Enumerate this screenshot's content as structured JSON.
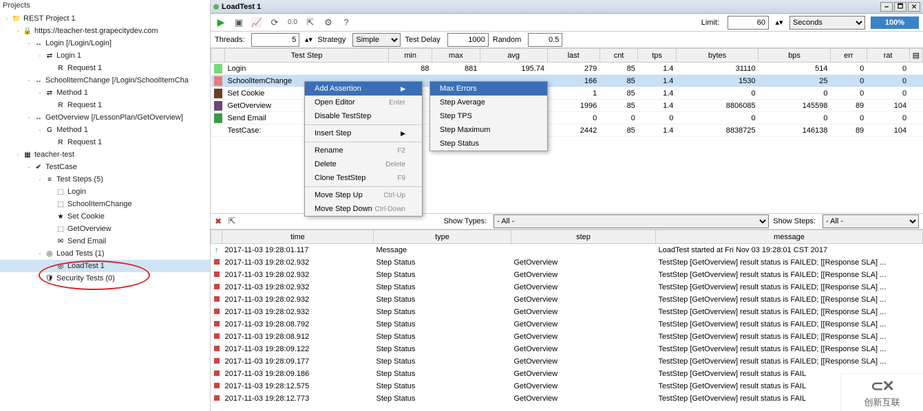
{
  "projects_header": "Projects",
  "tree": [
    {
      "indent": 0,
      "toggle": "-",
      "icon": "📁",
      "label": "REST Project 1"
    },
    {
      "indent": 1,
      "toggle": "-",
      "icon": "🔒",
      "label": "https://teacher-test.grapecitydev.com"
    },
    {
      "indent": 2,
      "toggle": "-",
      "icon": "↔",
      "label": "Login [/Login/Login]"
    },
    {
      "indent": 3,
      "toggle": "-",
      "icon": "⇄",
      "label": "Login 1"
    },
    {
      "indent": 4,
      "toggle": "",
      "icon": "R",
      "label": "Request 1"
    },
    {
      "indent": 2,
      "toggle": "-",
      "icon": "↔",
      "label": "SchoolItemChange [/Login/SchoolItemCha"
    },
    {
      "indent": 3,
      "toggle": "-",
      "icon": "⇄",
      "label": "Method 1"
    },
    {
      "indent": 4,
      "toggle": "",
      "icon": "R",
      "label": "Request 1"
    },
    {
      "indent": 2,
      "toggle": "-",
      "icon": "↔",
      "label": "GetOverview [/LessonPlan/GetOverview]"
    },
    {
      "indent": 3,
      "toggle": "-",
      "icon": "G",
      "label": "Method 1"
    },
    {
      "indent": 4,
      "toggle": "",
      "icon": "R",
      "label": "Request 1"
    },
    {
      "indent": 1,
      "toggle": "-",
      "icon": "▦",
      "label": "teacher-test"
    },
    {
      "indent": 2,
      "toggle": "-",
      "icon": "✔",
      "label": "TestCase"
    },
    {
      "indent": 3,
      "toggle": "-",
      "icon": "≡",
      "label": "Test Steps (5)"
    },
    {
      "indent": 4,
      "toggle": "",
      "icon": "⬚",
      "label": "Login"
    },
    {
      "indent": 4,
      "toggle": "",
      "icon": "⬚",
      "label": "SchoolItemChange"
    },
    {
      "indent": 4,
      "toggle": "",
      "icon": "★",
      "label": "Set Cookie"
    },
    {
      "indent": 4,
      "toggle": "",
      "icon": "⬚",
      "label": "GetOverview"
    },
    {
      "indent": 4,
      "toggle": "",
      "icon": "✉",
      "label": "Send Email"
    },
    {
      "indent": 3,
      "toggle": "-",
      "icon": "◎",
      "label": "Load Tests (1)"
    },
    {
      "indent": 4,
      "toggle": "",
      "icon": "◎",
      "label": "LoadTest 1",
      "selected": true
    },
    {
      "indent": 3,
      "toggle": "",
      "icon": "🛡",
      "label": "Security Tests (0)"
    }
  ],
  "title": "LoadTest 1",
  "limit_label": "Limit:",
  "limit_value": "60",
  "limit_unit": "Seconds",
  "progress": "100%",
  "threads_label": "Threads:",
  "threads_value": "5",
  "strategy_label": "Strategy",
  "strategy_value": "Simple",
  "testdelay_label": "Test Delay",
  "testdelay_value": "1000",
  "random_label": "Random",
  "random_value": "0.5",
  "stats_headers": [
    "Test Step",
    "min",
    "max",
    "avg",
    "last",
    "cnt",
    "tps",
    "bytes",
    "bps",
    "err",
    "rat"
  ],
  "stats_rows": [
    {
      "color": "#78d878",
      "name": "Login",
      "min": "88",
      "max": "881",
      "avg": "195.74",
      "last": "279",
      "cnt": "85",
      "tps": "1.4",
      "bytes": "31110",
      "bps": "514",
      "err": "0",
      "rat": "0"
    },
    {
      "color": "#e47f7f",
      "name": "SchoolItemChange",
      "min": "",
      "max": "",
      "avg": "",
      "last": "166",
      "cnt": "85",
      "tps": "1.4",
      "bytes": "1530",
      "bps": "25",
      "err": "0",
      "rat": "0",
      "sel": true
    },
    {
      "color": "#6b3f24",
      "name": "Set Cookie",
      "min": "",
      "max": "",
      "avg": "",
      "last": "1",
      "cnt": "85",
      "tps": "1.4",
      "bytes": "0",
      "bps": "0",
      "err": "0",
      "rat": "0"
    },
    {
      "color": "#6d4676",
      "name": "GetOverview",
      "min": "",
      "max": "",
      "avg": "",
      "last": "1996",
      "cnt": "85",
      "tps": "1.4",
      "bytes": "8806085",
      "bps": "145598",
      "err": "89",
      "rat": "104"
    },
    {
      "color": "#3a9948",
      "name": "Send Email",
      "min": "",
      "max": "",
      "avg": "",
      "last": "0",
      "cnt": "0",
      "tps": "0",
      "bytes": "0",
      "bps": "0",
      "err": "0",
      "rat": "0"
    },
    {
      "color": "",
      "name": "TestCase:",
      "min": "",
      "max": "",
      "avg": "",
      "last": "2442",
      "cnt": "85",
      "tps": "1.4",
      "bytes": "8838725",
      "bps": "146138",
      "err": "89",
      "rat": "104"
    }
  ],
  "ctx_main": [
    {
      "label": "Add Assertion",
      "arrow": true,
      "hl": true
    },
    {
      "label": "Open Editor",
      "shortcut": "Enter"
    },
    {
      "label": "Disable TestStep"
    },
    {
      "sep": true
    },
    {
      "label": "Insert Step",
      "arrow": true
    },
    {
      "sep": true
    },
    {
      "label": "Rename",
      "shortcut": "F2"
    },
    {
      "label": "Delete",
      "shortcut": "Delete"
    },
    {
      "label": "Clone TestStep",
      "shortcut": "F9"
    },
    {
      "sep": true
    },
    {
      "label": "Move Step Up",
      "shortcut": "Ctrl-Up"
    },
    {
      "label": "Move Step Down",
      "shortcut": "Ctrl-Down"
    }
  ],
  "ctx_sub": [
    {
      "label": "Max Errors",
      "hl": true
    },
    {
      "label": "Step Average"
    },
    {
      "label": "Step TPS"
    },
    {
      "label": "Step Maximum"
    },
    {
      "label": "Step Status"
    }
  ],
  "show_types_label": "Show Types:",
  "show_types_value": "- All -",
  "show_steps_label": "Show Steps:",
  "show_steps_value": "- All -",
  "log_headers": [
    "",
    "time",
    "type",
    "step",
    "message"
  ],
  "log_rows": [
    {
      "dot": "g",
      "start": true,
      "time": "2017-11-03 19:28:01.117",
      "type": "Message",
      "step": "",
      "msg": "LoadTest started at Fri Nov 03 19:28:01 CST 2017"
    },
    {
      "dot": "r",
      "time": "2017-11-03 19:28:02.932",
      "type": "Step Status",
      "step": "GetOverview",
      "msg": "TestStep [GetOverview] result status is FAILED; [[Response SLA] ..."
    },
    {
      "dot": "r",
      "time": "2017-11-03 19:28:02.932",
      "type": "Step Status",
      "step": "GetOverview",
      "msg": "TestStep [GetOverview] result status is FAILED; [[Response SLA] ..."
    },
    {
      "dot": "r",
      "time": "2017-11-03 19:28:02.932",
      "type": "Step Status",
      "step": "GetOverview",
      "msg": "TestStep [GetOverview] result status is FAILED; [[Response SLA] ..."
    },
    {
      "dot": "r",
      "time": "2017-11-03 19:28:02.932",
      "type": "Step Status",
      "step": "GetOverview",
      "msg": "TestStep [GetOverview] result status is FAILED; [[Response SLA] ..."
    },
    {
      "dot": "r",
      "time": "2017-11-03 19:28:02.932",
      "type": "Step Status",
      "step": "GetOverview",
      "msg": "TestStep [GetOverview] result status is FAILED; [[Response SLA] ..."
    },
    {
      "dot": "r",
      "time": "2017-11-03 19:28:08.792",
      "type": "Step Status",
      "step": "GetOverview",
      "msg": "TestStep [GetOverview] result status is FAILED; [[Response SLA] ..."
    },
    {
      "dot": "r",
      "time": "2017-11-03 19:28:08.912",
      "type": "Step Status",
      "step": "GetOverview",
      "msg": "TestStep [GetOverview] result status is FAILED; [[Response SLA] ..."
    },
    {
      "dot": "r",
      "time": "2017-11-03 19:28:09.122",
      "type": "Step Status",
      "step": "GetOverview",
      "msg": "TestStep [GetOverview] result status is FAILED; [[Response SLA] ..."
    },
    {
      "dot": "r",
      "time": "2017-11-03 19:28:09.177",
      "type": "Step Status",
      "step": "GetOverview",
      "msg": "TestStep [GetOverview] result status is FAILED; [[Response SLA] ..."
    },
    {
      "dot": "r",
      "time": "2017-11-03 19:28:09.186",
      "type": "Step Status",
      "step": "GetOverview",
      "msg": "TestStep [GetOverview] result status is FAIL"
    },
    {
      "dot": "r",
      "time": "2017-11-03 19:28:12.575",
      "type": "Step Status",
      "step": "GetOverview",
      "msg": "TestStep [GetOverview] result status is FAIL"
    },
    {
      "dot": "r",
      "time": "2017-11-03 19:28:12.773",
      "type": "Step Status",
      "step": "GetOverview",
      "msg": "TestStep [GetOverview] result status is FAIL"
    }
  ],
  "watermark": "创新互联"
}
